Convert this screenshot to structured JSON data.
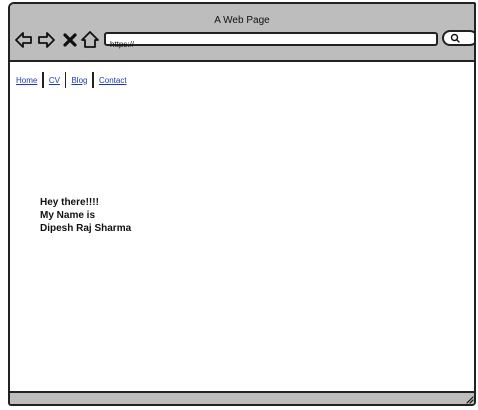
{
  "window": {
    "title": "A Web Page"
  },
  "toolbar": {
    "back_icon": "arrow-left-icon",
    "forward_icon": "arrow-right-icon",
    "stop_icon": "close-icon",
    "home_icon": "home-icon",
    "search_icon": "search-icon"
  },
  "address_bar": {
    "value": "https://"
  },
  "site_nav": {
    "items": [
      {
        "label": "Home"
      },
      {
        "label": "CV"
      },
      {
        "label": "Blog"
      },
      {
        "label": "Contact"
      }
    ]
  },
  "intro": {
    "line1": "Hey there!!!!",
    "line2": "My Name is",
    "line3": "Dipesh Raj Sharma"
  },
  "colors": {
    "chrome": "#bdbdbd",
    "link": "#1a3cb0",
    "border": "#222222"
  }
}
